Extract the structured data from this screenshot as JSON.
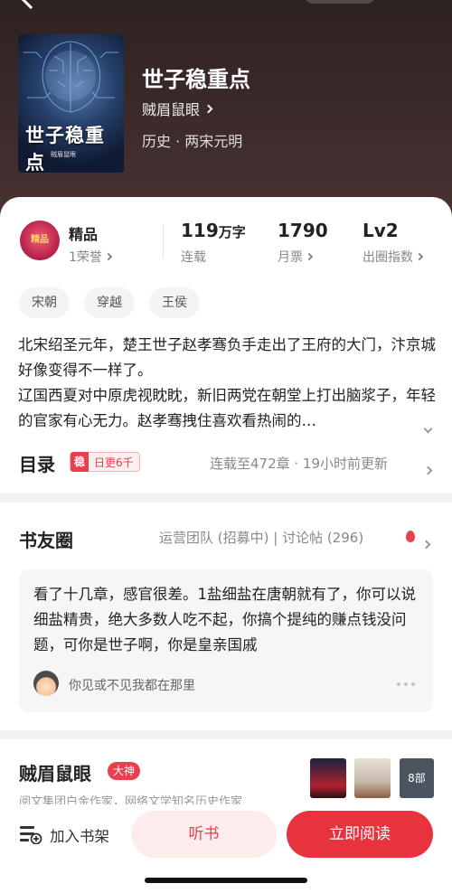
{
  "header": {
    "book_title": "世子稳重点",
    "author": "贼眉鼠眼",
    "genre": "历史 · 两宋元明",
    "cover_title": "世子稳重点",
    "cover_small": "贼眉鼠眼"
  },
  "stats": {
    "quality_badge_text": "精品",
    "honor_label": "精品",
    "honor_sub": "1荣誉",
    "word_count_value": "119",
    "word_count_unit": "万字",
    "word_count_sub": "连载",
    "monthly_ticket_value": "1790",
    "monthly_ticket_sub": "月票",
    "level_value": "Lv2",
    "level_sub": "出圈指数"
  },
  "tags": [
    "宋朝",
    "穿越",
    "王侯"
  ],
  "description": "北宋绍圣元年，楚王世子赵孝骞负手走出了王府的大门，汴京城好像变得不一样了。\n辽国西夏对中原虎视眈眈，新旧两党在朝堂上打出脑浆子，年轻的官家有心无力。赵孝骞拽住喜欢看热闹的…",
  "toc": {
    "label": "目录",
    "badge_icon": "稳",
    "badge_text": "日更6千",
    "status": "连载至472章 · 19小时前更新"
  },
  "circle": {
    "title": "书友圈",
    "meta": "运营团队 (招募中) | 讨论帖 (296)",
    "post_text": "看了十几章，感官很差。1盐细盐在唐朝就有了，你可以说细盐精贵，绝大多数人吃不起，你搞个提纯的赚点钱没问题，可你是世子啊，你是皇亲国戚",
    "post_user": "你见或不见我都在那里"
  },
  "author_section": {
    "name": "贼眉鼠眼",
    "badge": "大神",
    "desc": "阅文集团白金作家，网络文学知名历史作家",
    "more_label": "8部"
  },
  "bottom": {
    "shelf_label": "加入书架",
    "listen_label": "听书",
    "read_label": "立即阅读"
  },
  "colors": {
    "accent": "#e8333f",
    "accent_light": "#fdecec"
  }
}
